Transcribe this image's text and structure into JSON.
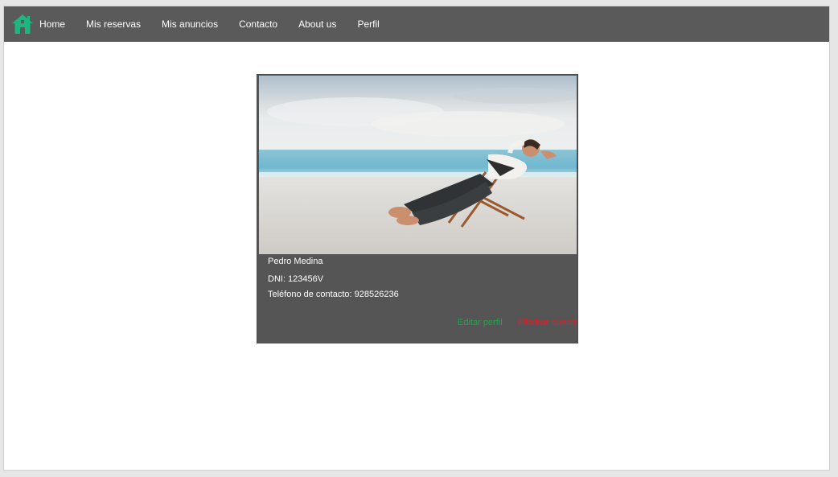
{
  "nav": {
    "logo_icon": "home-icon",
    "logo_color": "#1fb57f",
    "background": "#5a5a5a",
    "items": [
      {
        "label": "Home"
      },
      {
        "label": "Mis reservas"
      },
      {
        "label": "Mis anuncios"
      },
      {
        "label": "Contacto"
      },
      {
        "label": "About us"
      },
      {
        "label": "Perfil"
      }
    ]
  },
  "profile": {
    "photo_alt": "man-relaxing-on-beach-chair",
    "name": "Pedro Medina",
    "dni_label": "DNI: 123456V",
    "phone_label": "Teléfono de contacto: 928526236",
    "edit_label": "Editar perfil",
    "delete_label": "Eliminar cuenta",
    "edit_color": "#1ca84a",
    "delete_color": "#e0202a"
  }
}
